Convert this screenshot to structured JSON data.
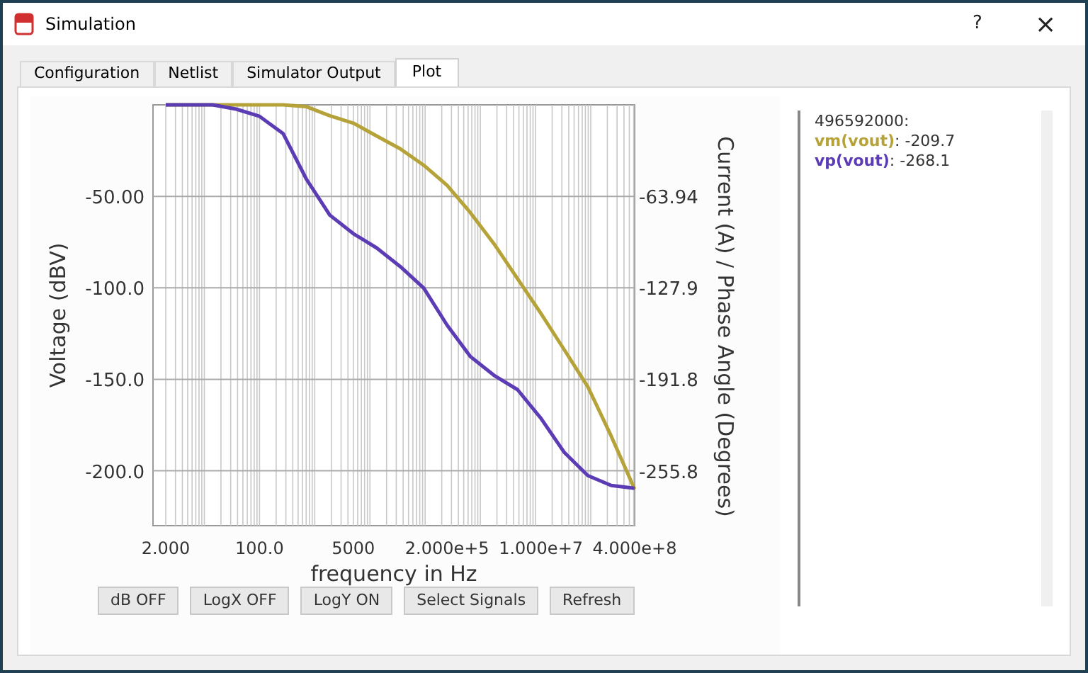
{
  "window": {
    "title": "Simulation",
    "help": "?",
    "close": "×"
  },
  "tabs": [
    {
      "label": "Configuration",
      "selected": false
    },
    {
      "label": "Netlist",
      "selected": false
    },
    {
      "label": "Simulator Output",
      "selected": false
    },
    {
      "label": "Plot",
      "selected": true
    }
  ],
  "plot": {
    "chart_data": {
      "type": "line",
      "xlabel": "frequency in Hz",
      "ylabel": "Voltage (dBV)",
      "y2label": "Current (A) / Phase Angle (Degrees)",
      "categories": [
        "2.000",
        null,
        null,
        null,
        "100.0",
        null,
        null,
        null,
        "5000",
        null,
        null,
        null,
        "2.000e+5",
        null,
        null,
        null,
        "1.000e+7",
        null,
        null,
        null,
        "4.000e+8"
      ],
      "grid": true,
      "ylim": [
        -230,
        0
      ],
      "y2lim": [
        -294.1,
        0
      ],
      "yticks": [
        {
          "value": -50,
          "label": "-50.00"
        },
        {
          "value": -100,
          "label": "-100.0"
        },
        {
          "value": -150,
          "label": "-150.0"
        },
        {
          "value": -200,
          "label": "-200.0"
        }
      ],
      "y2ticks": [
        {
          "value": -63.94,
          "label": "-63.94"
        },
        {
          "value": -127.9,
          "label": "-127.9"
        },
        {
          "value": -191.8,
          "label": "-191.8"
        },
        {
          "value": -255.8,
          "label": "-255.8"
        }
      ],
      "series": [
        {
          "name": "vm(vout)",
          "color": "#b5a33a",
          "values": [
            0,
            0,
            0,
            0,
            0,
            0,
            -1,
            -6,
            -10,
            -17,
            -24,
            -33,
            -44,
            -59,
            -76,
            -95,
            -114,
            -134,
            -154,
            -181,
            -210
          ]
        },
        {
          "name": "vp(vout)",
          "color": "#5b3cb4",
          "axis": "y2",
          "values": [
            0,
            0,
            0,
            -3,
            -8,
            -20,
            -52,
            -77,
            -90,
            -100,
            -113,
            -128,
            -154,
            -176,
            -189,
            -199,
            -219,
            -243,
            -259,
            -266,
            -268
          ]
        }
      ]
    },
    "buttons": [
      "dB OFF",
      "LogX OFF",
      "LogY ON",
      "Select Signals",
      "Refresh"
    ]
  },
  "legend": {
    "heading": "496592000:",
    "values": [
      ": -209.7",
      ": -268.1"
    ]
  }
}
